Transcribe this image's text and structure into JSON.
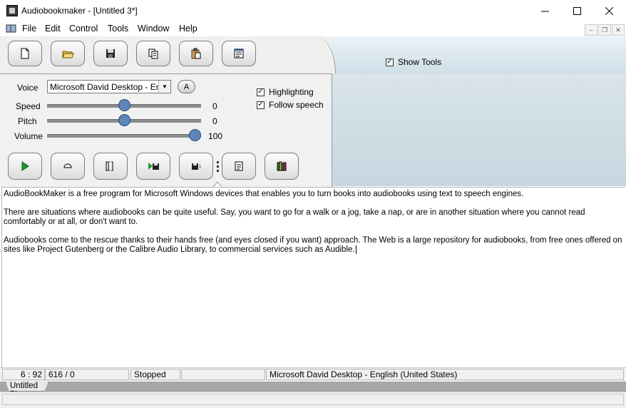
{
  "window": {
    "title": "Audiobookmaker - [Untitled 3*]"
  },
  "menu": [
    "File",
    "Edit",
    "Control",
    "Tools",
    "Window",
    "Help"
  ],
  "toolbar": {
    "show_tools_label": "Show Tools",
    "buttons": [
      {
        "name": "new-document-button",
        "icon": "new-document-icon"
      },
      {
        "name": "open-folder-button",
        "icon": "open-folder-icon"
      },
      {
        "name": "save-button",
        "icon": "save-icon"
      },
      {
        "name": "copy-button",
        "icon": "copy-icon"
      },
      {
        "name": "paste-button",
        "icon": "paste-icon"
      },
      {
        "name": "properties-button",
        "icon": "properties-icon"
      }
    ]
  },
  "controls": {
    "voice_label": "Voice",
    "voice_value": "Microsoft David Desktop - English (United States)",
    "a_button": "A",
    "highlighting_label": "Highlighting",
    "follow_speech_label": "Follow speech",
    "speed": {
      "label": "Speed",
      "value": "0",
      "level": 0.5
    },
    "pitch": {
      "label": "Pitch",
      "value": "0",
      "level": 0.5
    },
    "volume": {
      "label": "Volume",
      "value": "100",
      "level": 1.0
    }
  },
  "editor": {
    "paragraphs": [
      "AudioBookMaker is a free program for Microsoft Windows devices that enables you to turn books into audiobooks using text to speech engines.",
      "There are situations where audiobooks can be quite useful. Say, you want to go for a walk or a jog, take a nap, or are in another situation where you cannot read comfortably or at all, or don't want to.",
      "Audiobooks come to the rescue thanks to their hands free (and eyes closed if you want) approach. The Web is a large repository for audiobooks, from free ones offered on sites like Project Gutenberg or the Calibre Audio Library, to commercial services such as Audible."
    ]
  },
  "status": {
    "cursor": "6 : 92",
    "counts": "616 / 0",
    "state": "Stopped",
    "voice": "Microsoft David Desktop - English (United States)"
  },
  "tabs": [
    "Untitled 3*"
  ]
}
